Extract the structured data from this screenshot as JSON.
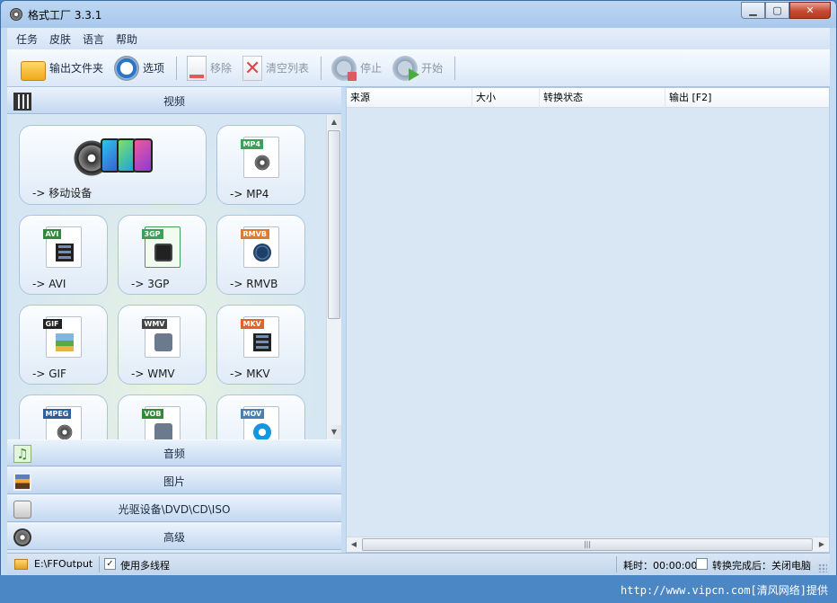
{
  "window": {
    "title": "格式工厂 3.3.1"
  },
  "menu": [
    "任务",
    "皮肤",
    "语言",
    "帮助"
  ],
  "toolbar": {
    "output_folder": "输出文件夹",
    "options": "选项",
    "remove": "移除",
    "clear_list": "清空列表",
    "stop": "停止",
    "start": "开始"
  },
  "categories": {
    "video": "视频",
    "audio": "音频",
    "image": "图片",
    "disc": "光驱设备\\DVD\\CD\\ISO",
    "advanced": "高级"
  },
  "formats": {
    "mobile": "-> 移动设备",
    "mp4": "-> MP4",
    "avi": "-> AVI",
    "3gp": "-> 3GP",
    "rmvb": "-> RMVB",
    "gif": "-> GIF",
    "wmv": "-> WMV",
    "mkv": "-> MKV"
  },
  "format_tags": {
    "mp4": "MP4",
    "avi": "AVI",
    "3gp": "3GP",
    "rmvb": "RMVB",
    "gif": "GIF",
    "wmv": "WMV",
    "mkv": "MKV",
    "mpeg": "MPEG",
    "vob": "VOB",
    "mov": "MOV"
  },
  "list_columns": [
    "来源",
    "大小",
    "转换状态",
    "输出 [F2]"
  ],
  "statusbar": {
    "output_path": "E:\\FFOutput",
    "multithread_label": "使用多线程",
    "multithread_checked": true,
    "elapsed": "耗时：00:00:00",
    "after_convert": "转换完成后：关闭电脑"
  },
  "watermark": "http://www.vipcn.com[清风网络]提供",
  "colors": {
    "titlebar": "#bcd7f2",
    "close_button": "#c74a30",
    "accent": "#2a74c9"
  }
}
